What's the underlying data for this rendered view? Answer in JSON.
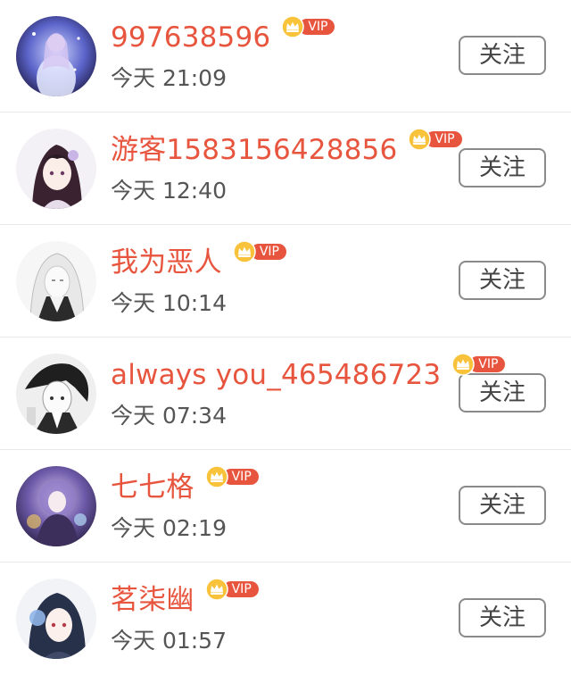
{
  "items": [
    {
      "name": "997638596",
      "vip": "VIP",
      "time": "今天 21:09",
      "follow": "关注",
      "accent": "#e8553e"
    },
    {
      "name": "游客1583156428856",
      "vip": "VIP",
      "time": "今天 12:40",
      "follow": "关注"
    },
    {
      "name": "我为恶人",
      "vip": "VIP",
      "time": "今天 10:14",
      "follow": "关注"
    },
    {
      "name": "always you_465486723",
      "vip": "VIP",
      "time": "今天 07:34",
      "follow": "关注"
    },
    {
      "name": "七七格",
      "vip": "VIP",
      "time": "今天 02:19",
      "follow": "关注"
    },
    {
      "name": "茗柒幽",
      "vip": "VIP",
      "time": "今天 01:57",
      "follow": "关注"
    }
  ],
  "icons": {
    "vip_crown": "crown-icon"
  }
}
